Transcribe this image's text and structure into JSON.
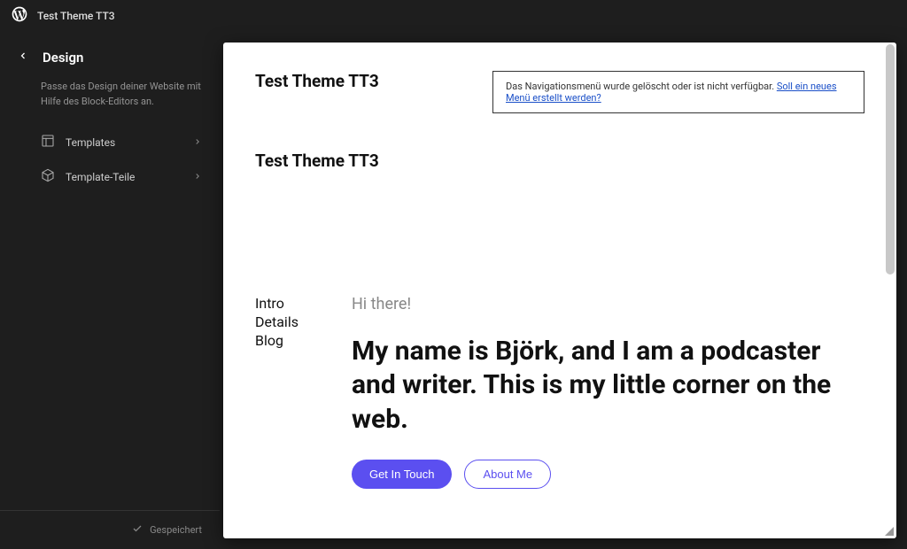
{
  "topbar": {
    "site_name": "Test Theme TT3"
  },
  "sidebar": {
    "title": "Design",
    "description": "Passe das Design deiner Website mit Hilfe des Block-Editors an.",
    "items": [
      {
        "label": "Templates"
      },
      {
        "label": "Template-Teile"
      }
    ],
    "saved_label": "Gespeichert"
  },
  "preview": {
    "header": {
      "site_title": "Test Theme TT3",
      "nav_notice_text": "Das Navigationsmenü wurde gelöscht oder ist nicht verfügbar. ",
      "nav_notice_link": "Soll ein neues Menü erstellt werden?"
    },
    "site_title_2": "Test Theme TT3",
    "hero": {
      "nav": [
        "Intro",
        "Details",
        "Blog"
      ],
      "greeting": "Hi there!",
      "heading": "My name is Björk, and I am a podcaster and writer. This is my little corner on the web.",
      "primary_button": "Get In Touch",
      "secondary_button": "About Me"
    }
  }
}
